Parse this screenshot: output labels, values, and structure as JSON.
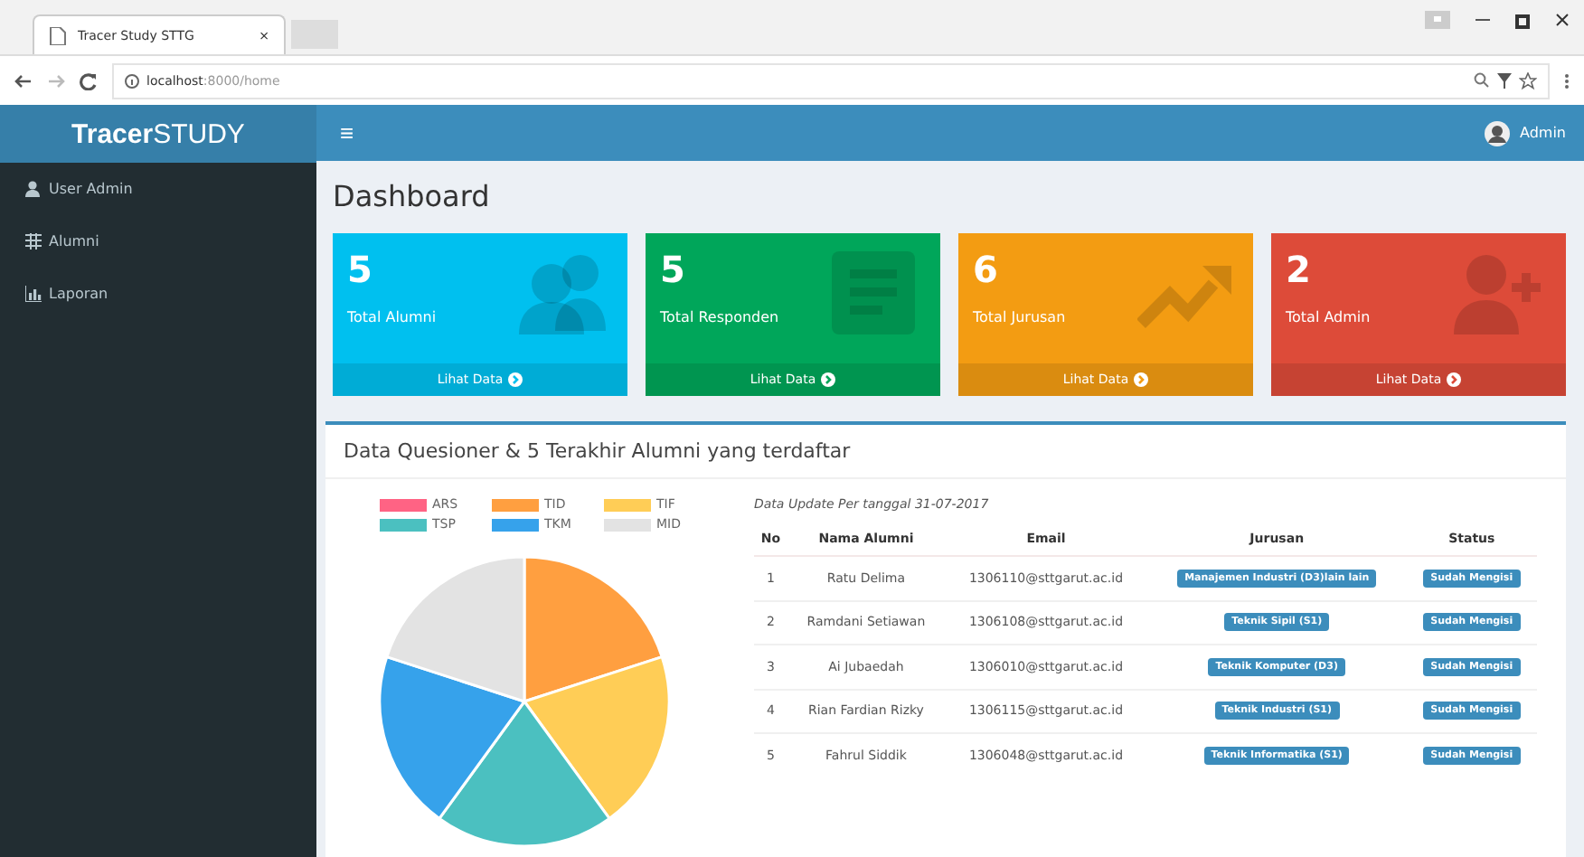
{
  "browser": {
    "tab_title": "Tracer Study STTG",
    "tab_close": "×",
    "url_host": "localhost",
    "url_path": ":8000/home"
  },
  "header": {
    "brand_bold": "Tracer",
    "brand_rest": "STUDY",
    "menu_glyph": "≡",
    "user": "Admin"
  },
  "sidebar": {
    "items": [
      {
        "label": "User Admin",
        "kind": "user"
      },
      {
        "label": "Alumni",
        "kind": "table"
      },
      {
        "label": "Laporan",
        "kind": "chart"
      }
    ]
  },
  "page_title": "Dashboard",
  "cards": [
    {
      "value": "5",
      "label": "Total Alumni",
      "link": "Lihat Data",
      "kind": "people",
      "color": "#00c0ef"
    },
    {
      "value": "5",
      "label": "Total Responden",
      "link": "Lihat Data",
      "kind": "list",
      "color": "#00a65a"
    },
    {
      "value": "6",
      "label": "Total Jurusan",
      "link": "Lihat Data",
      "kind": "trend",
      "color": "#f39c12"
    },
    {
      "value": "2",
      "label": "Total Admin",
      "link": "Lihat Data",
      "kind": "adduser",
      "color": "#dd4b39"
    }
  ],
  "box": {
    "title": "Data Quesioner & 5 Terakhir Alumni yang terdaftar",
    "chart_data": {
      "type": "pie",
      "categories": [
        "ARS",
        "TID",
        "TIF",
        "TSP",
        "TKM",
        "MID"
      ],
      "values": [
        0,
        20,
        20,
        20,
        20,
        20
      ],
      "legend": "top",
      "colors": [
        "#ff6384",
        "#ff9f40",
        "#ffcd56",
        "#4bc0c0",
        "#36a2eb",
        "#e3e3e3"
      ]
    },
    "update_note": "Data Update Per tanggal 31-07-2017",
    "table": {
      "columns": [
        "No",
        "Nama Alumni",
        "Email",
        "Jurusan",
        "Status"
      ],
      "rows": [
        [
          "1",
          "Ratu Delima",
          "1306110@sttgarut.ac.id",
          "Manajemen Industri (D3)lain lain",
          "Sudah Mengisi"
        ],
        [
          "2",
          "Ramdani Setiawan",
          "1306108@sttgarut.ac.id",
          "Teknik Sipil (S1)",
          "Sudah Mengisi"
        ],
        [
          "3",
          "Ai Jubaedah",
          "1306010@sttgarut.ac.id",
          "Teknik Komputer (D3)",
          "Sudah Mengisi"
        ],
        [
          "4",
          "Rian Fardian Rizky",
          "1306115@sttgarut.ac.id",
          "Teknik Industri (S1)",
          "Sudah Mengisi"
        ],
        [
          "5",
          "Fahrul Siddik",
          "1306048@sttgarut.ac.id",
          "Teknik Informatika (S1)",
          "Sudah Mengisi"
        ]
      ]
    }
  }
}
